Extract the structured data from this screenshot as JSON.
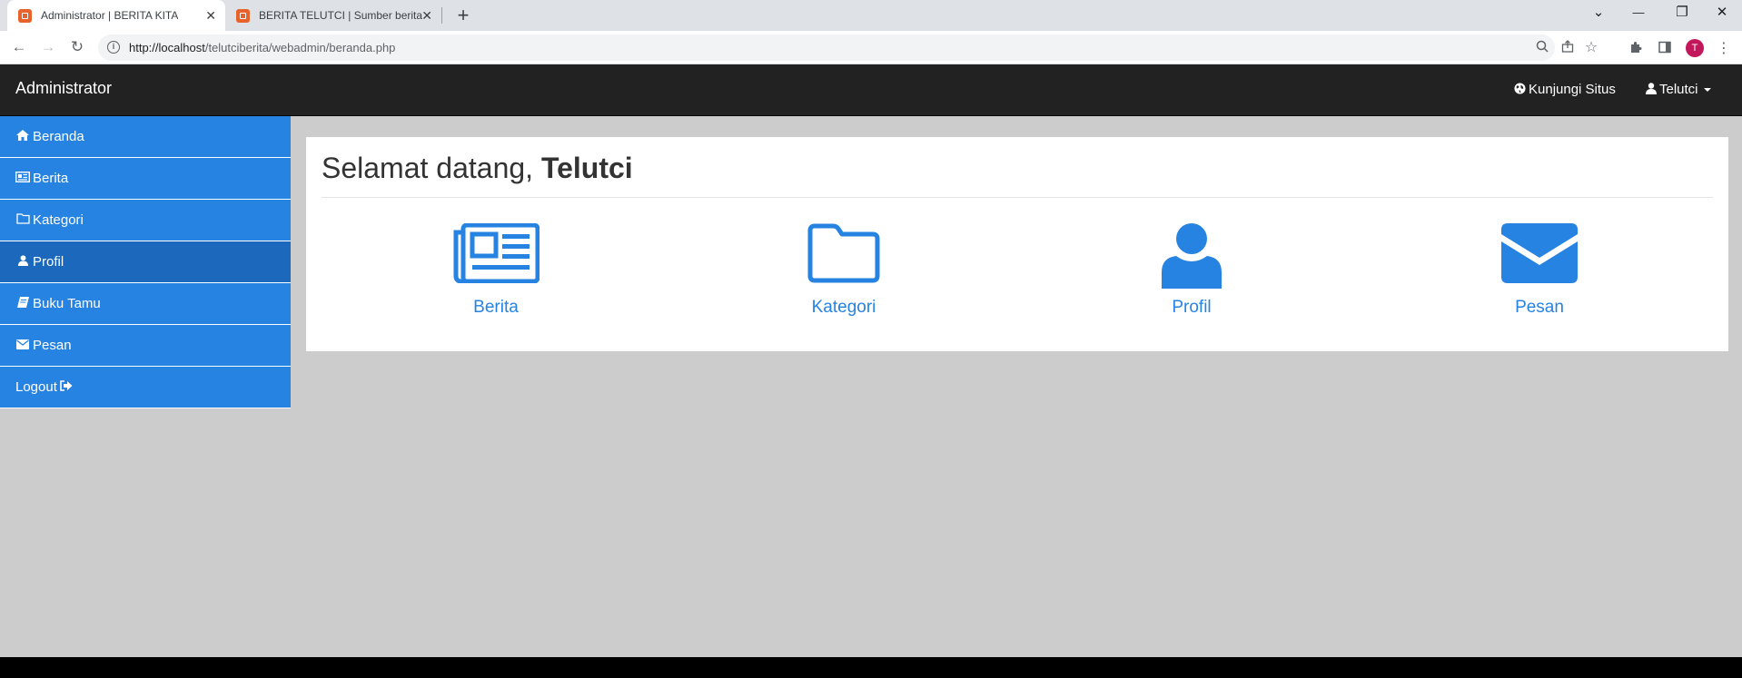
{
  "browser": {
    "tabs": [
      {
        "title": "Administrator | BERITA KITA",
        "close": "✕"
      },
      {
        "title": "BERITA TELUTCI | Sumber berita t",
        "close": "✕"
      }
    ],
    "new_tab": "+",
    "url_host": "http://localhost",
    "url_path": "/telutciberita/webadmin/beranda.php",
    "profile_initial": "T",
    "window_controls": {
      "minimize": "—",
      "restore": "❐",
      "close": "✕"
    }
  },
  "navbar": {
    "brand": "Administrator",
    "visit_site": "Kunjungi Situs",
    "user": "Telutci"
  },
  "sidebar": {
    "items": [
      {
        "label": "Beranda",
        "icon": "home-icon"
      },
      {
        "label": "Berita",
        "icon": "newspaper-icon"
      },
      {
        "label": "Kategori",
        "icon": "folder-icon"
      },
      {
        "label": "Profil",
        "icon": "user-icon",
        "active": true
      },
      {
        "label": "Buku Tamu",
        "icon": "book-icon"
      },
      {
        "label": "Pesan",
        "icon": "envelope-icon"
      },
      {
        "label": "Logout",
        "icon": "logout-icon"
      }
    ]
  },
  "main": {
    "welcome_prefix": "Selamat datang,",
    "welcome_name": "Telutci",
    "tiles": [
      {
        "label": "Berita",
        "icon": "newspaper-icon"
      },
      {
        "label": "Kategori",
        "icon": "folder-icon"
      },
      {
        "label": "Profil",
        "icon": "user-icon"
      },
      {
        "label": "Pesan",
        "icon": "envelope-icon"
      }
    ]
  },
  "colors": {
    "accent": "#2683e2",
    "sidebar_active": "#1b68bd",
    "navbar": "#222222",
    "page_bg": "#cccccc"
  }
}
